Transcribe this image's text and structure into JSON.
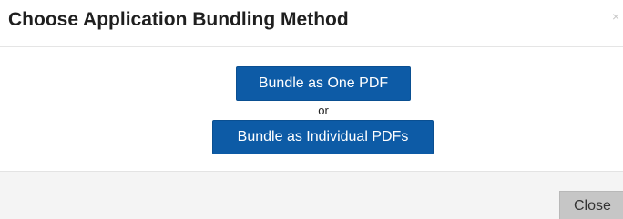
{
  "dialog": {
    "title": "Choose Application Bundling Method",
    "close_glyph": "×"
  },
  "body": {
    "bundle_one_label": "Bundle as One PDF",
    "separator_text": "or",
    "bundle_individual_label": "Bundle as Individual PDFs"
  },
  "footer": {
    "close_label": "Close"
  },
  "colors": {
    "primary_button": "#0d5ba6",
    "close_button": "#c6c6c6",
    "footer_background": "#f4f4f4"
  }
}
